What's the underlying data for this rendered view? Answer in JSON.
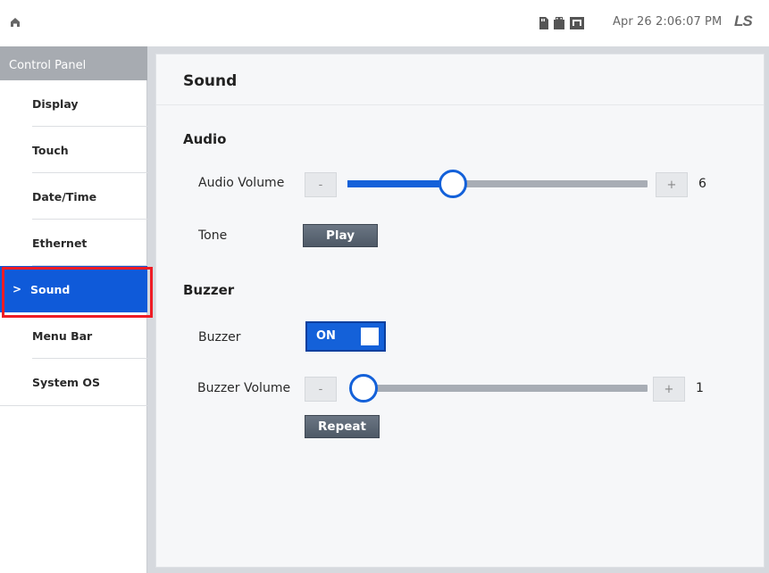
{
  "topbar": {
    "datetime": "Apr 26 2:06:07 PM",
    "brand": "LS"
  },
  "sidebar": {
    "header": "Control Panel",
    "items": [
      {
        "label": "Display"
      },
      {
        "label": "Touch"
      },
      {
        "label": "Date/Time"
      },
      {
        "label": "Ethernet"
      },
      {
        "label": "Sound",
        "selected": true
      },
      {
        "label": "Menu Bar"
      },
      {
        "label": "System OS"
      }
    ],
    "selected_chevron": ">"
  },
  "main": {
    "title": "Sound",
    "audio": {
      "section_title": "Audio",
      "volume_label": "Audio Volume",
      "decrement_label": "-",
      "increment_label": "+",
      "volume_value": "6",
      "volume_fraction": 0.35,
      "tone_label": "Tone",
      "play_label": "Play"
    },
    "buzzer": {
      "section_title": "Buzzer",
      "buzzer_label": "Buzzer",
      "toggle_label": "ON",
      "volume_label": "Buzzer Volume",
      "decrement_label": "-",
      "increment_label": "+",
      "volume_value": "1",
      "volume_fraction": 0.0,
      "repeat_label": "Repeat"
    }
  },
  "colors": {
    "accent": "#1461d9",
    "sidebar_active": "#0f5ad9",
    "highlight": "#ee1c25"
  }
}
